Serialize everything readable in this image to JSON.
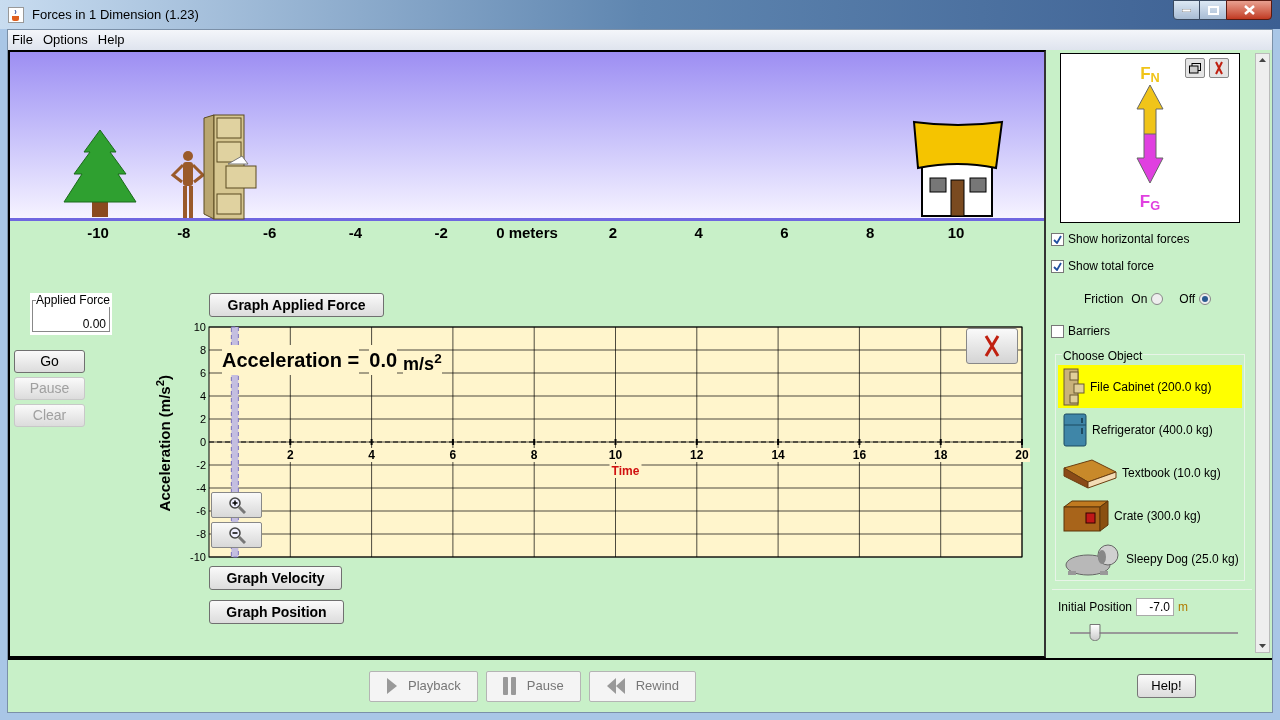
{
  "window": {
    "title": "Forces in 1 Dimension (1.23)"
  },
  "menu": [
    "File",
    "Options",
    "Help"
  ],
  "ruler": [
    "-10",
    "-8",
    "-6",
    "-4",
    "-2",
    "0 meters",
    "2",
    "4",
    "6",
    "8",
    "10"
  ],
  "applied_force": {
    "label": "Applied Force",
    "value": "0.00"
  },
  "controls": [
    {
      "label": "Go",
      "disabled": false
    },
    {
      "label": "Pause",
      "disabled": true
    },
    {
      "label": "Clear",
      "disabled": true
    }
  ],
  "graph_buttons": [
    "Graph Applied Force",
    "Graph Velocity",
    "Graph Position"
  ],
  "readout": {
    "label": "Acceleration =",
    "value": "0.0",
    "unit": "m/s$^{2}$"
  },
  "chart_data": {
    "type": "line",
    "xlabel": "Time",
    "ylabel": "Acceleration (m/s$^{2}$)",
    "xlim": [
      0,
      20
    ],
    "ylim": [
      -10,
      10
    ],
    "xticks": [
      2,
      4,
      6,
      8,
      10,
      12,
      14,
      16,
      18,
      20
    ],
    "yticks": [
      10,
      8,
      6,
      4,
      2,
      0,
      -2,
      -4,
      -6,
      -8,
      -10
    ],
    "grid": true,
    "ref_lines": [
      {
        "axis": "y",
        "value": 0
      }
    ]
  },
  "playback": [
    {
      "label": "Playback",
      "kind": "play",
      "disabled": true
    },
    {
      "label": "Pause",
      "kind": "pause",
      "disabled": true
    },
    {
      "label": "Rewind",
      "kind": "rewind",
      "disabled": true
    }
  ],
  "help_button": "Help!",
  "forces": [
    {
      "label": "F$_{N}$",
      "kind": "up",
      "color": "#f0c419"
    },
    {
      "label": "F$_{G}$",
      "kind": "down",
      "color": "#e040e0"
    }
  ],
  "checks": [
    {
      "label": "Show horizontal forces",
      "checked": true
    },
    {
      "label": "Show total force",
      "checked": true
    }
  ],
  "friction": {
    "label": "Friction",
    "options": [
      {
        "label": "On",
        "selected": false
      },
      {
        "label": "Off",
        "selected": true
      }
    ]
  },
  "barriers": {
    "label": "Barriers",
    "checked": false
  },
  "objects": {
    "title": "Choose Object",
    "items": [
      {
        "label": "File Cabinet (200.0 kg)",
        "kind": "cabinet",
        "selected": true
      },
      {
        "label": "Refrigerator (400.0 kg)",
        "kind": "fridge",
        "selected": false
      },
      {
        "label": "Textbook (10.0 kg)",
        "kind": "book",
        "selected": false
      },
      {
        "label": "Crate (300.0 kg)",
        "kind": "crate",
        "selected": false
      },
      {
        "label": "Sleepy Dog (25.0 kg)",
        "kind": "dog",
        "selected": false
      }
    ]
  },
  "initial_position": {
    "label": "Initial Position",
    "value": "-7.0",
    "unit": "m",
    "level": 0.15
  }
}
